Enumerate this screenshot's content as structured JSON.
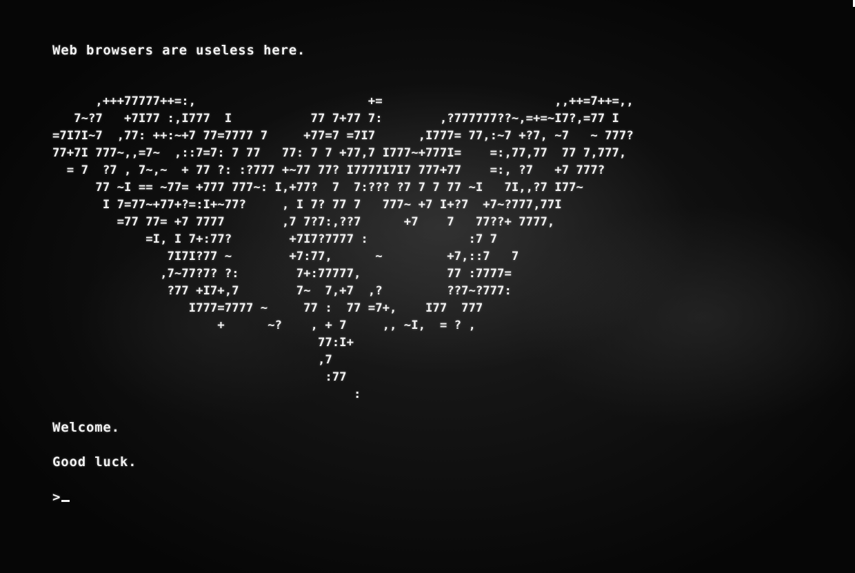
{
  "terminal": {
    "header_text": "Web browsers are useless here.",
    "ascii_art": [
      "      ,+++77777++=:,                        +=                        ,,++=7++=,,",
      "   7~?7   +7I77 :,I777  I           77 7+77 7:        ,?777777??~,=+=~I7?,=77 I",
      "=7I7I~7  ,77: ++:~+7 77=7777 7     +77=7 =7I7      ,I777= 77,:~7 +?7, ~7   ~ 777?",
      "77+7I 777~,,=7~  ,::7=7: 7 77   77: 7 7 +77,7 I777~+777I=    =:,77,77  77 7,777,",
      "  = 7  ?7 , 7~,~  + 77 ?: :?777 +~77 77? I7777I7I7 777+77    =:, ?7   +7 777?",
      "      77 ~I == ~77= +777 777~: I,+77?  7  7:??? ?7 7 7 77 ~I   7I,,?7 I77~",
      "       I 7=77~+77+?=:I+~77?     , I 7? 77 7   777~ +7 I+?7  +7~?777,77I",
      "         =77 77= +7 7777        ,7 7?7:,??7      +7    7   77??+ 7777,",
      "             =I, I 7+:77?        +7I7?7777 :              :7 7",
      "                7I7I?77 ~        +7:77,      ~         +7,::7   7",
      "               ,7~77?7? ?:        7+:77777,            77 :7777=",
      "                ?77 +I7+,7        7~  7,+7  ,?         ??7~?777:",
      "                   I777=7777 ~     77 :  77 =7+,    I77  777",
      "                       +      ~?    , + 7     ,, ~I,  = ? ,",
      "                                     77:I+",
      "                                     ,7",
      "                                      :77",
      "                                          :"
    ],
    "welcome_text": "Welcome.",
    "luck_text": "Good luck.",
    "prompt_symbol": ">"
  }
}
